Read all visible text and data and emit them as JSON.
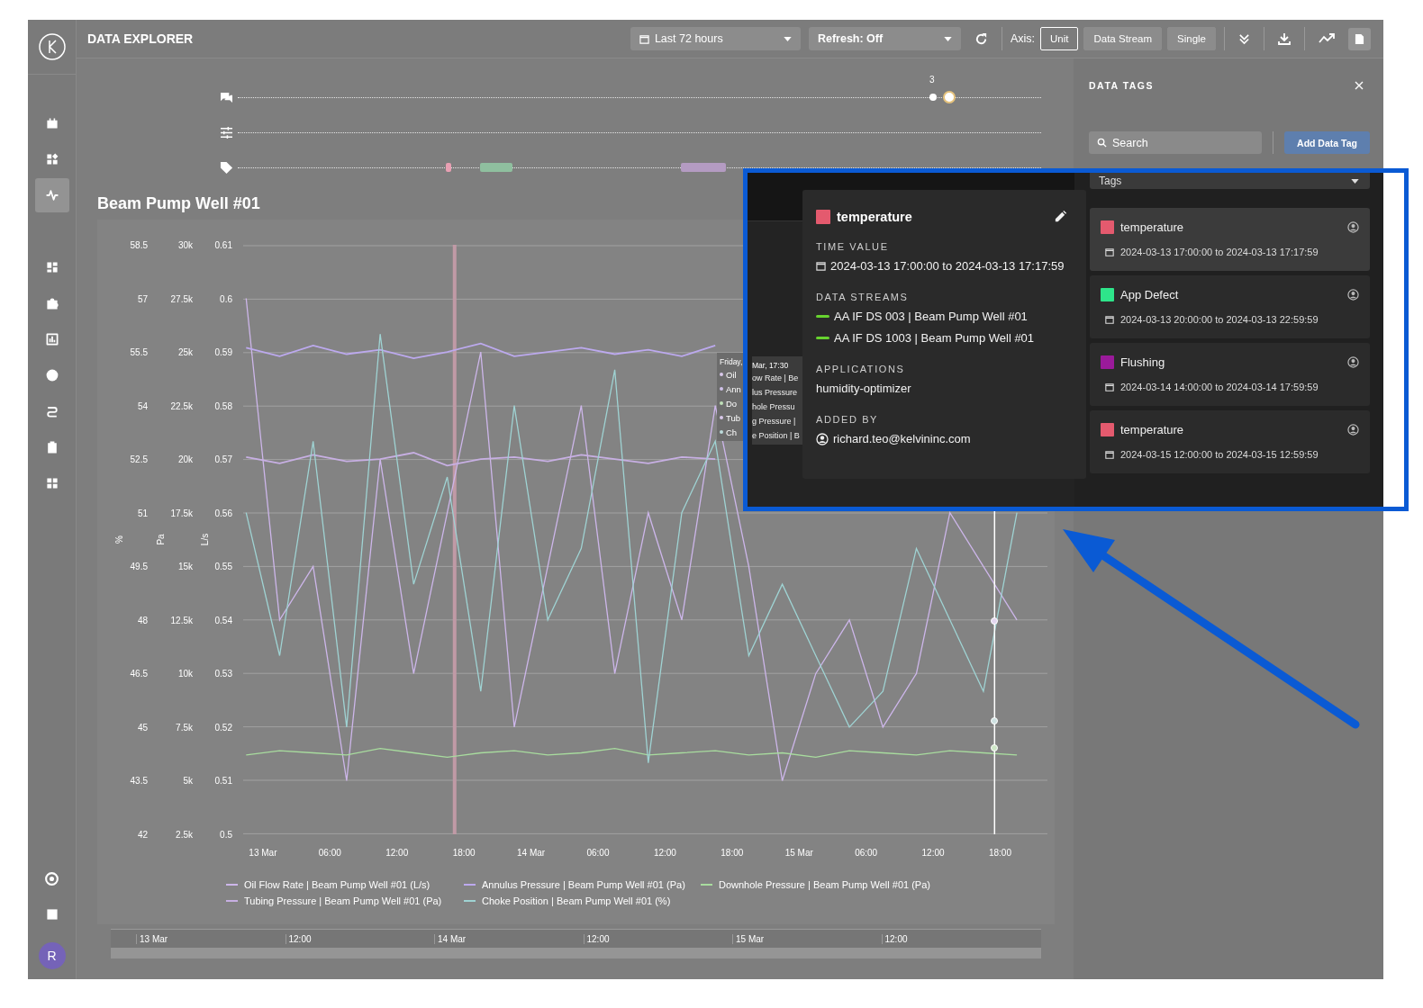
{
  "app": {
    "title": "DATA EXPLORER",
    "user_initial": "R"
  },
  "sidebar": {
    "items": [
      {
        "selected": false
      },
      {
        "selected": false
      },
      {
        "selected": true
      },
      {
        "selected": false
      },
      {
        "selected": false
      },
      {
        "selected": false
      },
      {
        "selected": false
      },
      {
        "selected": false
      },
      {
        "selected": false
      },
      {
        "selected": false
      }
    ]
  },
  "toolbar": {
    "time_range": "Last 72 hours",
    "refresh": "Refresh: Off",
    "axis_label": "Axis:",
    "axis_options": [
      {
        "label": "Unit",
        "selected": true
      },
      {
        "label": "Data Stream",
        "selected": false
      },
      {
        "label": "Single",
        "selected": false
      }
    ]
  },
  "timeline": {
    "comment_count": "3",
    "tag_markers": [
      {
        "color": "#e8a0b3"
      },
      {
        "color": "#8fbf9f"
      },
      {
        "color": "#b49bc2"
      }
    ]
  },
  "chart": {
    "title": "Beam Pump Well #01",
    "axis_titles": [
      "%",
      "Pa",
      "L/s"
    ],
    "chart_data": {
      "type": "line",
      "grid": true,
      "bands": [
        {
          "axis": "x",
          "from": "2024-03-13T17:00",
          "to": "2024-03-13T17:18",
          "color": "#c09aa6"
        }
      ],
      "ref_lines": [
        {
          "axis": "x",
          "value": "2024-03-15T17:30",
          "color": "#ffffff"
        }
      ],
      "xlim": [
        "2024-03-12T22:14",
        "2024-03-15T22:14"
      ],
      "x": [
        "2024-03-12T22:30",
        "2024-03-13T01:30",
        "2024-03-13T04:30",
        "2024-03-13T07:30",
        "2024-03-13T10:30",
        "2024-03-13T13:30",
        "2024-03-13T16:30",
        "2024-03-13T19:30",
        "2024-03-13T22:30",
        "2024-03-14T01:30",
        "2024-03-14T04:30",
        "2024-03-14T07:30",
        "2024-03-14T10:30",
        "2024-03-14T13:30",
        "2024-03-14T16:30",
        "2024-03-14T19:30",
        "2024-03-14T22:30",
        "2024-03-15T01:30",
        "2024-03-15T04:30",
        "2024-03-15T07:30",
        "2024-03-15T10:30",
        "2024-03-15T13:30",
        "2024-03-15T16:30",
        "2024-03-15T19:30"
      ],
      "xticks": [
        {
          "value": "2024-03-13T00:00",
          "label": "13 Mar"
        },
        {
          "value": "2024-03-13T06:00",
          "label": "06:00"
        },
        {
          "value": "2024-03-13T12:00",
          "label": "12:00"
        },
        {
          "value": "2024-03-13T18:00",
          "label": "18:00"
        },
        {
          "value": "2024-03-14T00:00",
          "label": "14 Mar"
        },
        {
          "value": "2024-03-14T06:00",
          "label": "06:00"
        },
        {
          "value": "2024-03-14T12:00",
          "label": "12:00"
        },
        {
          "value": "2024-03-14T18:00",
          "label": "18:00"
        },
        {
          "value": "2024-03-15T00:00",
          "label": "15 Mar"
        },
        {
          "value": "2024-03-15T06:00",
          "label": "06:00"
        },
        {
          "value": "2024-03-15T12:00",
          "label": "12:00"
        },
        {
          "value": "2024-03-15T18:00",
          "label": "18:00"
        }
      ],
      "ylim": [
        42,
        58.5
      ],
      "yticks": [
        {
          "value": 58.5,
          "label": "58.5"
        },
        {
          "value": 57,
          "label": "57"
        },
        {
          "value": 55.5,
          "label": "55.5"
        },
        {
          "value": 54,
          "label": "54"
        },
        {
          "value": 52.5,
          "label": "52.5"
        },
        {
          "value": 51,
          "label": "51"
        },
        {
          "value": 49.5,
          "label": "49.5"
        },
        {
          "value": 48,
          "label": "48"
        },
        {
          "value": 46.5,
          "label": "46.5"
        },
        {
          "value": 45,
          "label": "45"
        },
        {
          "value": 43.5,
          "label": "43.5"
        },
        {
          "value": 42,
          "label": "42"
        }
      ],
      "y2lim": [
        2500,
        30000
      ],
      "y2ticks": [
        {
          "value": 30000,
          "label": "30k"
        },
        {
          "value": 27500,
          "label": "27.5k"
        },
        {
          "value": 25000,
          "label": "25k"
        },
        {
          "value": 22500,
          "label": "22.5k"
        },
        {
          "value": 20000,
          "label": "20k"
        },
        {
          "value": 17500,
          "label": "17.5k"
        },
        {
          "value": 15000,
          "label": "15k"
        },
        {
          "value": 12500,
          "label": "12.5k"
        },
        {
          "value": 10000,
          "label": "10k"
        },
        {
          "value": 7500,
          "label": "7.5k"
        },
        {
          "value": 5000,
          "label": "5k"
        },
        {
          "value": 2500,
          "label": "2.5k"
        }
      ],
      "y3lim": [
        0.5,
        0.61
      ],
      "y3ticks": [
        {
          "value": 0.61,
          "label": "0.61"
        },
        {
          "value": 0.6,
          "label": "0.6"
        },
        {
          "value": 0.59,
          "label": "0.59"
        },
        {
          "value": 0.58,
          "label": "0.58"
        },
        {
          "value": 0.57,
          "label": "0.57"
        },
        {
          "value": 0.56,
          "label": "0.56"
        },
        {
          "value": 0.55,
          "label": "0.55"
        },
        {
          "value": 0.54,
          "label": "0.54"
        },
        {
          "value": 0.53,
          "label": "0.53"
        },
        {
          "value": 0.52,
          "label": "0.52"
        },
        {
          "value": 0.51,
          "label": "0.51"
        },
        {
          "value": 0.5,
          "label": "0.5"
        }
      ],
      "series": [
        {
          "name": "Oil Flow Rate | Beam Pump Well #01 (L/s)",
          "color": "#cdb6ea",
          "axis": "y3",
          "values": [
            0.6,
            0.54,
            0.55,
            0.51,
            0.57,
            0.53,
            0.56,
            0.59,
            0.52,
            0.55,
            0.58,
            0.53,
            0.56,
            0.54,
            0.58,
            0.55,
            0.51,
            0.53,
            0.54,
            0.52,
            0.53,
            0.56,
            0.55,
            0.54
          ]
        },
        {
          "name": "Annulus Pressure | Beam Pump Well #01 (Pa)",
          "color": "#bca9ee",
          "axis": "y2",
          "values": [
            25200,
            24800,
            25300,
            24900,
            25100,
            24700,
            25000,
            25400,
            24800,
            25000,
            25200,
            24900,
            25100,
            24800,
            25300,
            null,
            null,
            null,
            null,
            null,
            null,
            null,
            null,
            null
          ]
        },
        {
          "name": "Downhole Pressure | Beam Pump Well #01 (Pa)",
          "color": "#a8dc9e",
          "axis": "y2",
          "values": [
            6200,
            6400,
            6300,
            6200,
            6500,
            6300,
            6100,
            6300,
            6400,
            6200,
            6300,
            6500,
            6200,
            6300,
            6400,
            6200,
            6300,
            6100,
            6400,
            6300,
            6200,
            6400,
            6300,
            6200
          ]
        },
        {
          "name": "Tubing Pressure | Beam Pump Well #01 (Pa)",
          "color": "#c7afe3",
          "axis": "y2",
          "values": [
            20100,
            19800,
            20200,
            19900,
            20000,
            20300,
            19700,
            20000,
            20100,
            19900,
            20200,
            20000,
            19800,
            20100,
            20000,
            null,
            null,
            null,
            null,
            null,
            null,
            null,
            null,
            null
          ]
        },
        {
          "name": "Choke Position | Beam Pump Well #01 (%)",
          "color": "#9fd3d3",
          "values": [
            51,
            47,
            53,
            45,
            56,
            49,
            52,
            46,
            54,
            48,
            50,
            55,
            44,
            51,
            53,
            47,
            49,
            47,
            45,
            46,
            50,
            48,
            46,
            51
          ]
        }
      ]
    },
    "tooltip": {
      "title_parts": [
        "Friday,",
        "Mar, 17:30"
      ],
      "rows": [
        {
          "color": "#d9c8ea",
          "parts": [
            "Oil",
            "ow Rate | Be"
          ]
        },
        {
          "color": "#d0c2ea",
          "parts": [
            "Ann",
            "lus Pressure"
          ]
        },
        {
          "color": "#bfe0b8",
          "parts": [
            "Do",
            "hole Pressu"
          ]
        },
        {
          "color": "#d9c8ea",
          "parts": [
            "Tub",
            "g Pressure |"
          ]
        },
        {
          "color": "#bcdada",
          "parts": [
            "Ch",
            "e Position | B"
          ]
        }
      ]
    },
    "navigator": {
      "labels": [
        "13 Mar",
        "12:00",
        "14 Mar",
        "12:00",
        "15 Mar",
        "12:00"
      ]
    }
  },
  "data_tags_panel": {
    "title": "DATA TAGS",
    "search": {
      "placeholder": "Search"
    },
    "add_button": "Add Data Tag",
    "filter": "Tags",
    "tags": [
      {
        "name": "temperature",
        "color": "#e45a6e",
        "range": "2024-03-13 17:00:00 to 2024-03-13 17:17:59",
        "selected": true
      },
      {
        "name": "App Defect",
        "color": "#2ee58a",
        "range": "2024-03-13 20:00:00 to 2024-03-13 22:59:59",
        "selected": false
      },
      {
        "name": "Flushing",
        "color": "#9a1a9a",
        "range": "2024-03-14 14:00:00 to 2024-03-14 17:59:59",
        "selected": false
      },
      {
        "name": "temperature",
        "color": "#e45a6e",
        "range": "2024-03-15 12:00:00 to 2024-03-15 12:59:59",
        "selected": false
      }
    ]
  },
  "tag_popup": {
    "name": "temperature",
    "color": "#e45a6e",
    "sections": [
      {
        "kind": "time",
        "label": "TIME VALUE",
        "items": [
          "2024-03-13 17:00:00 to 2024-03-13 17:17:59"
        ]
      },
      {
        "kind": "stream",
        "label": "DATA STREAMS",
        "items": [
          "AA IF DS 003 | Beam Pump Well #01",
          "AA IF DS 1003 | Beam Pump Well #01"
        ]
      },
      {
        "kind": "text",
        "label": "APPLICATIONS",
        "items": [
          "humidity-optimizer"
        ]
      },
      {
        "kind": "user",
        "label": "ADDED BY",
        "items": [
          "richard.teo@kelvininc.com"
        ]
      }
    ]
  }
}
